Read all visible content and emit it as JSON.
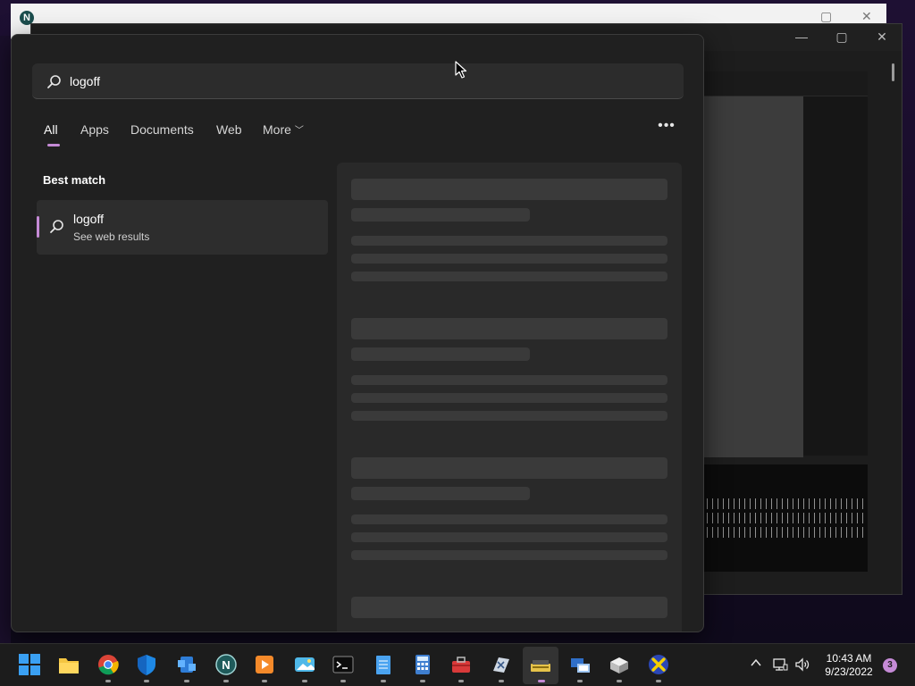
{
  "search": {
    "value": "logoff",
    "placeholder": ""
  },
  "tabs": [
    {
      "label": "All",
      "active": true
    },
    {
      "label": "Apps",
      "active": false
    },
    {
      "label": "Documents",
      "active": false
    },
    {
      "label": "Web",
      "active": false
    },
    {
      "label": "More",
      "active": false,
      "icon": "chevron-down-icon"
    }
  ],
  "more_options_icon": "ellipsis-icon",
  "best_match": {
    "section_label": "Best match",
    "result_title": "logoff",
    "result_subtitle": "See web results",
    "icon": "search-icon"
  },
  "taskbar": {
    "icons": [
      "start-icon",
      "file-explorer-icon",
      "chrome-icon",
      "defender-shield-icon",
      "app-blue-icon",
      "netsurf-icon",
      "media-player-icon",
      "photos-icon",
      "terminal-icon",
      "notepad-icon",
      "calculator-icon",
      "toolbox-icon",
      "app-x-icon",
      "scanner-icon",
      "network-app-icon",
      "package-icon",
      "app-yellow-x-icon"
    ],
    "tray": {
      "icons": [
        "show-hidden-icons-chevron-icon",
        "network-icon",
        "volume-icon"
      ],
      "time": "10:43 AM",
      "date": "9/23/2022",
      "notification_count": "3"
    }
  },
  "colors": {
    "accent": "#c58ad6",
    "flyout_bg": "#202020",
    "selected_bg": "#2d2d2d",
    "taskbar_bg": "#1c1c1c"
  }
}
